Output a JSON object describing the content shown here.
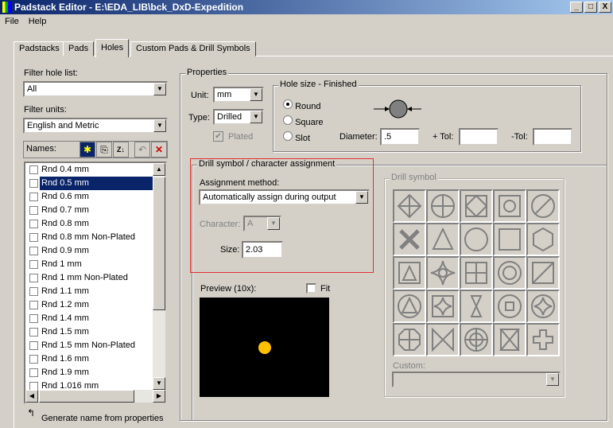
{
  "window": {
    "title": "Padstack Editor - E:\\EDA_LIB\\bck_DxD-Expedition",
    "min": "_",
    "max": "□",
    "close": "X"
  },
  "menu": [
    "File",
    "Help"
  ],
  "tabs": [
    "Padstacks",
    "Pads",
    "Holes",
    "Custom Pads & Drill Symbols"
  ],
  "active_tab": "Holes",
  "left": {
    "filter_hole_label": "Filter hole list:",
    "filter_hole_value": "All",
    "filter_units_label": "Filter units:",
    "filter_units_value": "English and Metric",
    "names_label": "Names:",
    "items": [
      {
        "name": "Rnd 0.4 mm",
        "selected": false
      },
      {
        "name": "Rnd 0.5 mm",
        "selected": true
      },
      {
        "name": "Rnd 0.6 mm",
        "selected": false
      },
      {
        "name": "Rnd 0.7 mm",
        "selected": false
      },
      {
        "name": "Rnd 0.8 mm",
        "selected": false
      },
      {
        "name": "Rnd 0.8 mm Non-Plated",
        "selected": false
      },
      {
        "name": "Rnd 0.9 mm",
        "selected": false
      },
      {
        "name": "Rnd 1 mm",
        "selected": false
      },
      {
        "name": "Rnd 1 mm Non-Plated",
        "selected": false
      },
      {
        "name": "Rnd 1.1 mm",
        "selected": false
      },
      {
        "name": "Rnd 1.2 mm",
        "selected": false
      },
      {
        "name": "Rnd 1.4 mm",
        "selected": false
      },
      {
        "name": "Rnd 1.5 mm",
        "selected": false
      },
      {
        "name": "Rnd 1.5 mm Non-Plated",
        "selected": false
      },
      {
        "name": "Rnd 1.6 mm",
        "selected": false
      },
      {
        "name": "Rnd 1.9 mm",
        "selected": false
      },
      {
        "name": "Rnd 1.016 mm",
        "selected": false
      }
    ],
    "generate_label": "Generate name from properties"
  },
  "properties": {
    "label": "Properties",
    "unit_label": "Unit:",
    "unit_value": "mm",
    "type_label": "Type:",
    "type_value": "Drilled",
    "plated_label": "Plated",
    "hole_size": {
      "label": "Hole size - Finished",
      "options": [
        "Round",
        "Square",
        "Slot"
      ],
      "selected": "Round",
      "diameter_label": "Diameter:",
      "diameter_value": ".5",
      "plus_tol_label": "+ Tol:",
      "plus_tol_value": "",
      "minus_tol_label": "-Tol:",
      "minus_tol_value": ""
    },
    "drill_assign": {
      "label": "Drill symbol / character assignment",
      "method_label": "Assignment method:",
      "method_value": "Automatically assign during output",
      "character_label": "Character:",
      "character_value": "A",
      "size_label": "Size:",
      "size_value": "2.03"
    },
    "preview": {
      "label": "Preview (10x):",
      "fit_label": "Fit"
    },
    "drill_symbol": {
      "label": "Drill symbol",
      "custom_label": "Custom:",
      "custom_value": ""
    }
  },
  "colors": {
    "highlight": "#e03030",
    "preview_bg": "#000000",
    "preview_dot": "#ffc000"
  }
}
